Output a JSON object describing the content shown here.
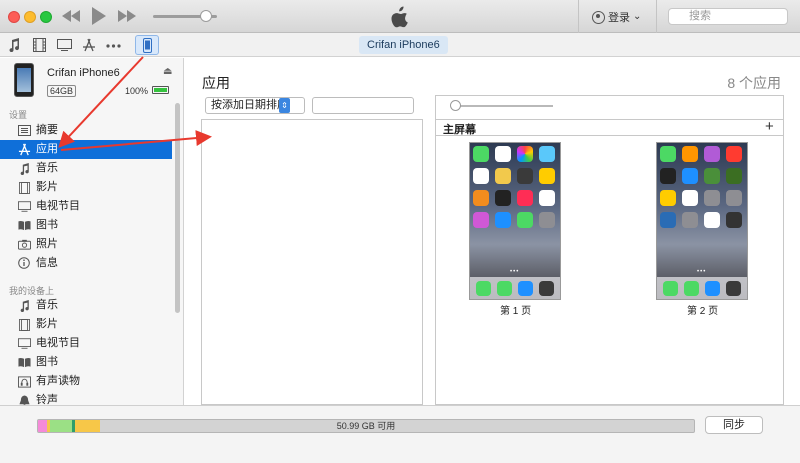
{
  "titlebar": {
    "login_label": "登录",
    "login_caret": "⌄",
    "search_placeholder": "搜索",
    "search_glyph": "🔍︎"
  },
  "toolbar": {
    "device_label": "Crifan iPhone6",
    "icons": [
      "music-note-icon",
      "film-icon",
      "tv-icon",
      "app-store-icon",
      "more-icon",
      "iphone-icon"
    ]
  },
  "device": {
    "name": "Crifan iPhone6",
    "capacity": "64GB",
    "battery": "100%",
    "eject_glyph": "⏏"
  },
  "sidebar": {
    "settings_label": "设置",
    "settings_items": [
      {
        "label": "摘要",
        "icon": "summary-icon"
      },
      {
        "label": "应用",
        "icon": "app-store-icon"
      },
      {
        "label": "音乐",
        "icon": "music-note-icon"
      },
      {
        "label": "影片",
        "icon": "film-icon"
      },
      {
        "label": "电视节目",
        "icon": "tv-icon"
      },
      {
        "label": "图书",
        "icon": "book-icon"
      },
      {
        "label": "照片",
        "icon": "camera-icon"
      },
      {
        "label": "信息",
        "icon": "info-icon"
      }
    ],
    "ondevice_label": "我的设备上",
    "ondevice_items": [
      {
        "label": "音乐",
        "icon": "music-note-icon"
      },
      {
        "label": "影片",
        "icon": "film-icon"
      },
      {
        "label": "电视节目",
        "icon": "tv-icon"
      },
      {
        "label": "图书",
        "icon": "book-icon"
      },
      {
        "label": "有声读物",
        "icon": "audiobook-icon"
      },
      {
        "label": "铃声",
        "icon": "bell-icon"
      }
    ]
  },
  "main": {
    "title": "应用",
    "app_count": "8 个应用",
    "sort_label": "按添加日期排序",
    "sort_arrow": "⇕",
    "home_screen_label": "主屏幕",
    "add_glyph": "+",
    "pages": [
      {
        "label": "第 1 页"
      },
      {
        "label": "第 2 页"
      }
    ]
  },
  "footer": {
    "capacity_text": "50.99 GB 可用",
    "sync_label": "同步",
    "capacity_colors": [
      "#f58ad8",
      "#f4c64f",
      "#9be085",
      "#2f9e6b",
      "#f7c748"
    ]
  }
}
